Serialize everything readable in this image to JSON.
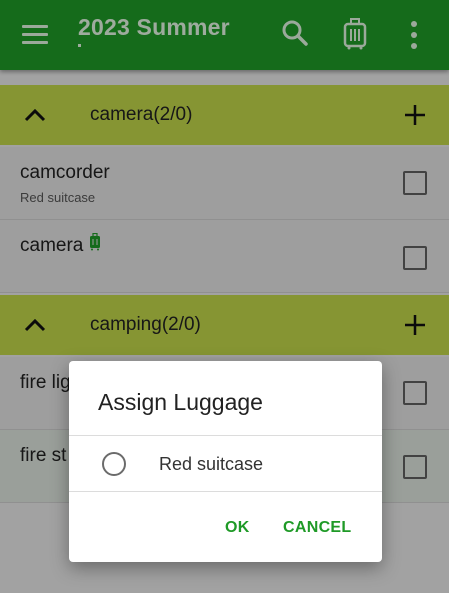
{
  "appbar": {
    "title": "2023 Summer",
    "icons": [
      "menu-icon",
      "search-icon",
      "luggage-icon",
      "more-vert-icon"
    ],
    "color": "#1f9a27"
  },
  "groups": [
    {
      "label": "camera(2/0)",
      "items": [
        {
          "name": "camcorder",
          "sub": "Red suitcase",
          "checked": false
        },
        {
          "name": "camera",
          "sub": "",
          "luggage_icon": true,
          "checked": false
        }
      ]
    },
    {
      "label": "camping(2/0)",
      "items": [
        {
          "name": "fire lig",
          "checked": false
        },
        {
          "name": "fire st",
          "checked": false
        }
      ]
    }
  ],
  "dialog": {
    "title": "Assign Luggage",
    "options": [
      {
        "label": "Red suitcase",
        "selected": false
      }
    ],
    "ok_label": "OK",
    "cancel_label": "CANCEL"
  },
  "colors": {
    "accent": "#1f9a27",
    "group_header": "#c0d64a"
  }
}
